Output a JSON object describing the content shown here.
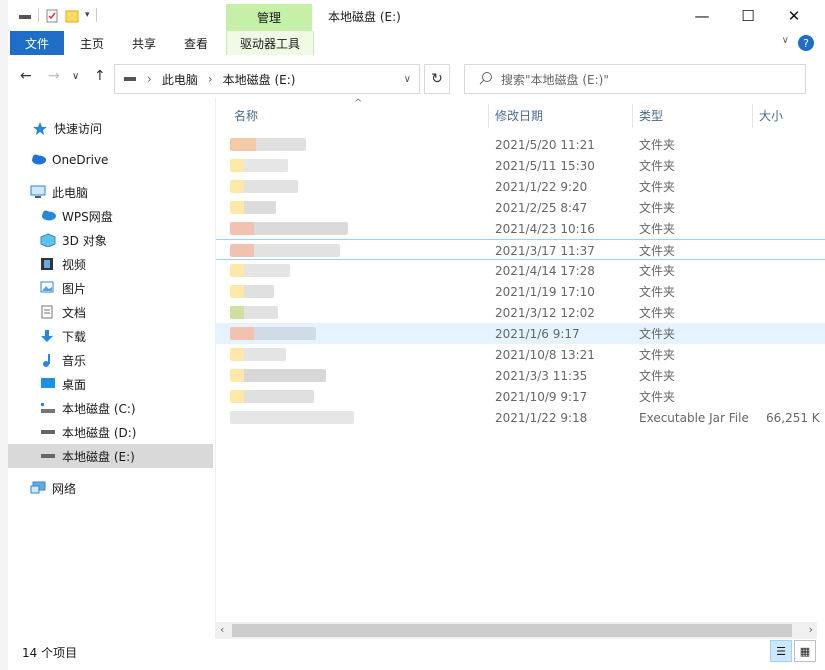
{
  "window": {
    "title": "本地磁盘 (E:)",
    "context_tab": "管理"
  },
  "ribbon": {
    "file": "文件",
    "home": "主页",
    "share": "共享",
    "view": "查看",
    "driver_tools": "驱动器工具",
    "help": "?"
  },
  "address": {
    "crumbs": [
      "此电脑",
      "本地磁盘 (E:)"
    ]
  },
  "search": {
    "placeholder": "搜索\"本地磁盘 (E:)\""
  },
  "nav": {
    "items": [
      {
        "label": "快速访问",
        "icon": "star-icon"
      },
      {
        "label": "OneDrive",
        "icon": "cloud-icon"
      },
      {
        "label": "此电脑",
        "icon": "computer-icon"
      },
      {
        "label": "WPS网盘",
        "icon": "cloud-icon"
      },
      {
        "label": "3D 对象",
        "icon": "cube-icon"
      },
      {
        "label": "视频",
        "icon": "film-icon"
      },
      {
        "label": "图片",
        "icon": "picture-icon"
      },
      {
        "label": "文档",
        "icon": "document-icon"
      },
      {
        "label": "下载",
        "icon": "download-icon"
      },
      {
        "label": "音乐",
        "icon": "music-icon"
      },
      {
        "label": "桌面",
        "icon": "desktop-icon"
      },
      {
        "label": "本地磁盘 (C:)",
        "icon": "drive-icon"
      },
      {
        "label": "本地磁盘 (D:)",
        "icon": "drive-icon"
      },
      {
        "label": "本地磁盘 (E:)",
        "icon": "drive-icon"
      },
      {
        "label": "网络",
        "icon": "network-icon"
      }
    ]
  },
  "columns": {
    "name": "名称",
    "modified": "修改日期",
    "type": "类型",
    "size": "大小"
  },
  "files": [
    {
      "modified": "2021/5/20 11:21",
      "type": "文件夹",
      "size": ""
    },
    {
      "modified": "2021/5/11 15:30",
      "type": "文件夹",
      "size": ""
    },
    {
      "modified": "2021/1/22 9:20",
      "type": "文件夹",
      "size": ""
    },
    {
      "modified": "2021/2/25 8:47",
      "type": "文件夹",
      "size": ""
    },
    {
      "modified": "2021/4/23 10:16",
      "type": "文件夹",
      "size": ""
    },
    {
      "modified": "2021/3/17 11:37",
      "type": "文件夹",
      "size": ""
    },
    {
      "modified": "2021/4/14 17:28",
      "type": "文件夹",
      "size": ""
    },
    {
      "modified": "2021/1/19 17:10",
      "type": "文件夹",
      "size": ""
    },
    {
      "modified": "2021/3/12 12:02",
      "type": "文件夹",
      "size": ""
    },
    {
      "modified": "2021/1/6 9:17",
      "type": "文件夹",
      "size": ""
    },
    {
      "modified": "2021/10/8 13:21",
      "type": "文件夹",
      "size": ""
    },
    {
      "modified": "2021/3/3 11:35",
      "type": "文件夹",
      "size": ""
    },
    {
      "modified": "2021/10/9 9:17",
      "type": "文件夹",
      "size": ""
    },
    {
      "modified": "2021/1/22 9:18",
      "type": "Executable Jar File",
      "size": "66,251 K"
    }
  ],
  "status": {
    "count": "14 个项目"
  },
  "colors": {
    "accent": "#1e6ec8",
    "context_tab": "#c6f0a8",
    "header_text": "#4b6a8a",
    "selected": "#d9d9d9",
    "hover": "#e5f3ff"
  }
}
